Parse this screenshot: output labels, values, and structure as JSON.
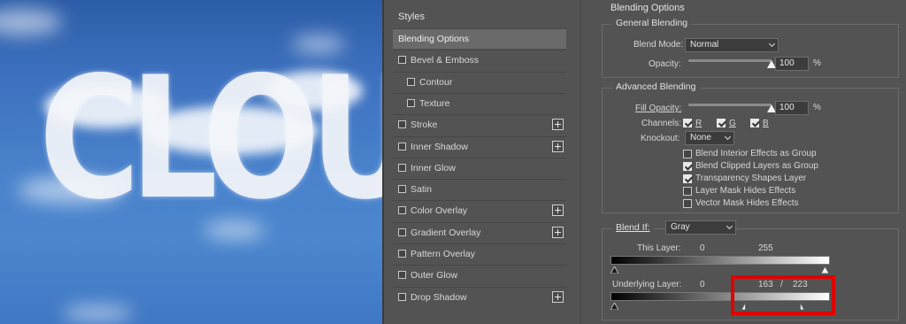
{
  "canvas": {
    "text": "CLOUD"
  },
  "styles_panel": {
    "header": "Styles",
    "items": [
      {
        "label": "Blending Options",
        "checkbox": false,
        "plus": false,
        "selected": true,
        "indent": 0
      },
      {
        "label": "Bevel & Emboss",
        "checkbox": true,
        "plus": false,
        "selected": false,
        "indent": 0
      },
      {
        "label": "Contour",
        "checkbox": true,
        "plus": false,
        "selected": false,
        "indent": 1
      },
      {
        "label": "Texture",
        "checkbox": true,
        "plus": false,
        "selected": false,
        "indent": 1
      },
      {
        "label": "Stroke",
        "checkbox": true,
        "plus": true,
        "selected": false,
        "indent": 0
      },
      {
        "label": "Inner Shadow",
        "checkbox": true,
        "plus": true,
        "selected": false,
        "indent": 0
      },
      {
        "label": "Inner Glow",
        "checkbox": true,
        "plus": false,
        "selected": false,
        "indent": 0
      },
      {
        "label": "Satin",
        "checkbox": true,
        "plus": false,
        "selected": false,
        "indent": 0
      },
      {
        "label": "Color Overlay",
        "checkbox": true,
        "plus": true,
        "selected": false,
        "indent": 0
      },
      {
        "label": "Gradient Overlay",
        "checkbox": true,
        "plus": true,
        "selected": false,
        "indent": 0
      },
      {
        "label": "Pattern Overlay",
        "checkbox": true,
        "plus": false,
        "selected": false,
        "indent": 0
      },
      {
        "label": "Outer Glow",
        "checkbox": true,
        "plus": false,
        "selected": false,
        "indent": 0
      },
      {
        "label": "Drop Shadow",
        "checkbox": true,
        "plus": true,
        "selected": false,
        "indent": 0
      }
    ]
  },
  "options": {
    "title": "Blending Options",
    "general": {
      "legend": "General Blending",
      "blend_mode_label": "Blend Mode:",
      "blend_mode_value": "Normal",
      "opacity_label": "Opacity:",
      "opacity_value": "100",
      "opacity_unit": "%",
      "opacity_level": 1.0
    },
    "advanced": {
      "legend": "Advanced Blending",
      "fill_opacity_label": "Fill Opacity:",
      "fill_opacity_value": "100",
      "fill_opacity_unit": "%",
      "fill_opacity_level": 1.0,
      "channels_label": "Channels:",
      "channels": [
        {
          "label": "R",
          "checked": true
        },
        {
          "label": "G",
          "checked": true
        },
        {
          "label": "B",
          "checked": true
        }
      ],
      "knockout_label": "Knockout:",
      "knockout_value": "None",
      "checks": [
        {
          "label": "Blend Interior Effects as Group",
          "checked": false
        },
        {
          "label": "Blend Clipped Layers as Group",
          "checked": true
        },
        {
          "label": "Transparency Shapes Layer",
          "checked": true
        },
        {
          "label": "Layer Mask Hides Effects",
          "checked": false
        },
        {
          "label": "Vector Mask Hides Effects",
          "checked": false
        }
      ]
    },
    "blend_if": {
      "label": "Blend If:",
      "value": "Gray",
      "this_layer_label": "This Layer:",
      "this_layer_min": "0",
      "this_layer_max": "255",
      "underlying_label": "Underlying Layer:",
      "underlying_min": "0",
      "underlying_split_low": "163",
      "underlying_sep": "/",
      "underlying_split_high": "223"
    }
  },
  "colors": {
    "highlight_box": "#e00000",
    "panel_bg": "#535353"
  }
}
